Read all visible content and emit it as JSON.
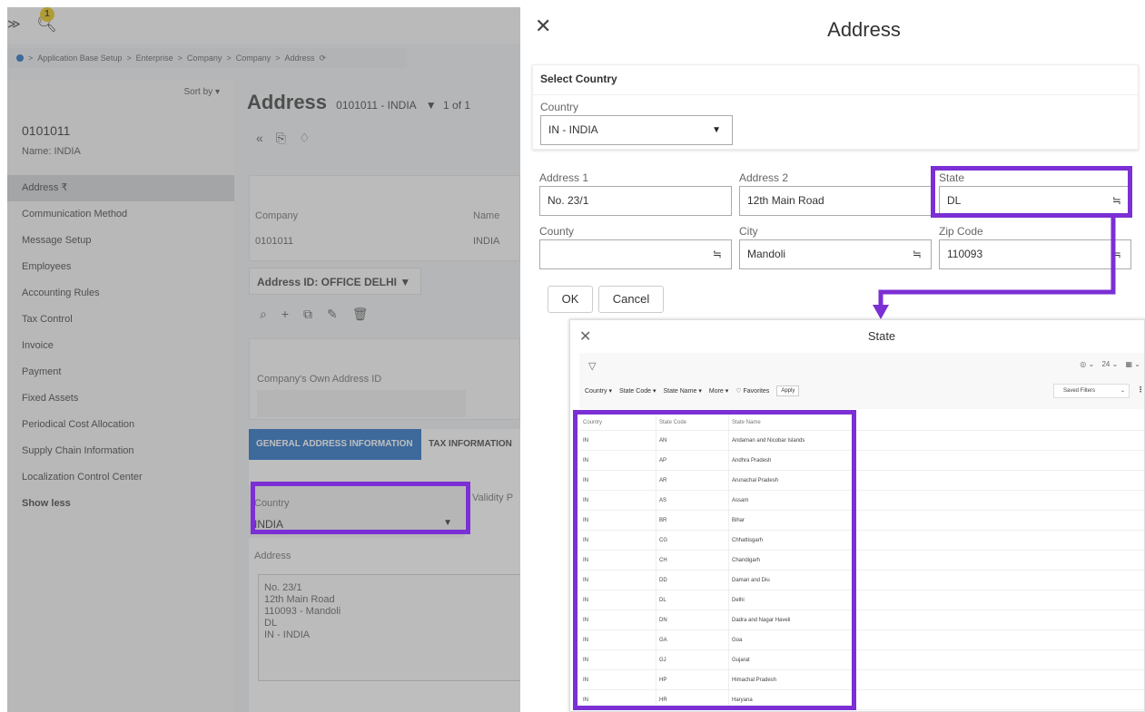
{
  "background": {
    "notification_count": "1",
    "breadcrumb": [
      "Application Base Setup",
      "Enterprise",
      "Company",
      "Company",
      "Address"
    ],
    "sort_by": "Sort by",
    "record_id": "0101011",
    "record_name": "Name:  INDIA",
    "nav_items": [
      {
        "label": "Address",
        "pin": "₹"
      },
      {
        "label": "Communication Method"
      },
      {
        "label": "Message Setup"
      },
      {
        "label": "Employees"
      },
      {
        "label": "Accounting Rules"
      },
      {
        "label": "Tax Control"
      },
      {
        "label": "Invoice"
      },
      {
        "label": "Payment"
      },
      {
        "label": "Fixed Assets"
      },
      {
        "label": "Periodical Cost Allocation"
      },
      {
        "label": "Supply Chain Information"
      },
      {
        "label": "Localization Control Center"
      },
      {
        "label": "Show less"
      }
    ],
    "page_title": "Address",
    "page_subtitle": "0101011 - INDIA",
    "page_count": "1 of 1",
    "company_label": "Company",
    "company_value": "0101011",
    "name_label": "Name",
    "name_value": "INDIA",
    "address_id_label": "Address ID: OFFICE DELHI",
    "own_address_label": "Company's Own Address ID",
    "tab_general": "GENERAL ADDRESS INFORMATION",
    "tab_tax": "TAX INFORMATION",
    "country_label": "Country",
    "country_value": "INDIA",
    "validity_label": "Validity P",
    "address_label": "Address",
    "address_block": "No. 23/1\n12th Main Road\n110093 - Mandoli\nDL\nIN - INDIA"
  },
  "dialog": {
    "title": "Address",
    "select_country_title": "Select Country",
    "country_label": "Country",
    "country_value": "IN - INDIA",
    "address1_label": "Address 1",
    "address1_value": "No. 23/1",
    "address2_label": "Address 2",
    "address2_value": "12th Main Road",
    "state_label": "State",
    "state_value": "DL",
    "county_label": "County",
    "county_value": "",
    "city_label": "City",
    "city_value": "Mandoli",
    "zip_label": "Zip Code",
    "zip_value": "110093",
    "ok_label": "OK",
    "cancel_label": "Cancel"
  },
  "state_lookup": {
    "title": "State",
    "page_size": "24",
    "filters": [
      "Country ▾",
      "State Code ▾",
      "State Name ▾",
      "More ▾",
      "♡ Favorites"
    ],
    "apply_label": "Apply",
    "saved_filters_label": "Saved Filters",
    "columns": [
      "Country",
      "State Code",
      "State Name"
    ],
    "rows": [
      [
        "IN",
        "AN",
        "Andaman and Nicobar Islands"
      ],
      [
        "IN",
        "AP",
        "Andhra Pradesh"
      ],
      [
        "IN",
        "AR",
        "Arunachal Pradesh"
      ],
      [
        "IN",
        "AS",
        "Assam"
      ],
      [
        "IN",
        "BR",
        "Bihar"
      ],
      [
        "IN",
        "CG",
        "Chhattisgarh"
      ],
      [
        "IN",
        "CH",
        "Chandigarh"
      ],
      [
        "IN",
        "DD",
        "Daman and Diu"
      ],
      [
        "IN",
        "DL",
        "Delhi"
      ],
      [
        "IN",
        "DN",
        "Dadra and Nagar Haveli"
      ],
      [
        "IN",
        "GA",
        "Goa"
      ],
      [
        "IN",
        "GJ",
        "Gujarat"
      ],
      [
        "IN",
        "HP",
        "Himachal Pradesh"
      ],
      [
        "IN",
        "HR",
        "Haryana"
      ]
    ]
  },
  "colors": {
    "highlight": "#7b2fd4",
    "tab_active": "#1565c0"
  }
}
